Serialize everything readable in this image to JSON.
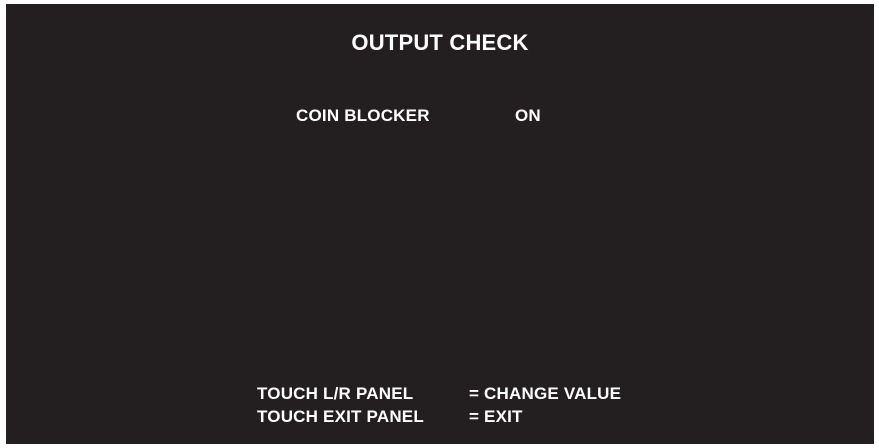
{
  "screen": {
    "title": "OUTPUT CHECK",
    "item": {
      "label": "COIN BLOCKER",
      "value": "ON"
    },
    "help": [
      {
        "key": "TOUCH L/R PANEL",
        "action": "= CHANGE VALUE"
      },
      {
        "key": "TOUCH EXIT PANEL",
        "action": "= EXIT"
      }
    ]
  },
  "colors": {
    "background": "#231f20",
    "text": "#ffffff"
  }
}
